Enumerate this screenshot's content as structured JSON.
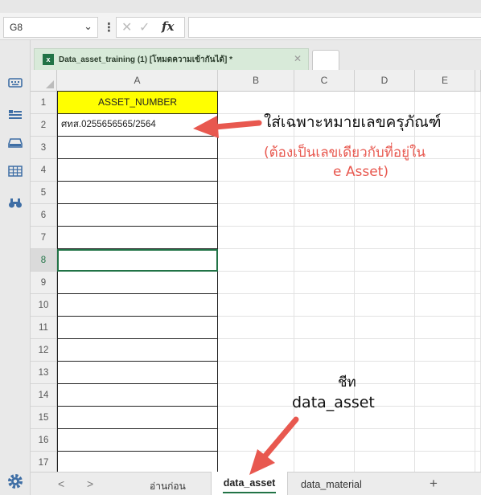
{
  "formula_bar": {
    "name_box": "G8",
    "name_box_arrow": "⌄",
    "separator": "⋮",
    "cancel_symbol": "✕",
    "confirm_symbol": "✓",
    "fx_label": "fx",
    "formula_value": ""
  },
  "document_tab": {
    "label": "Data_asset_training (1) [โหมดความเข้ากันได้] *",
    "icon_letter": "x",
    "close_symbol": "✕"
  },
  "grid": {
    "columns": [
      "A",
      "B",
      "C",
      "D",
      "E"
    ],
    "rows": [
      "1",
      "2",
      "3",
      "4",
      "5",
      "6",
      "7",
      "8",
      "9",
      "10",
      "11",
      "12",
      "13",
      "14",
      "15",
      "16",
      "17"
    ],
    "active_row": "8",
    "cells": {
      "A1": "ASSET_NUMBER",
      "A2": "ศทส.0255656565/2564"
    }
  },
  "sheet_tabs": {
    "prev_arrow": "<",
    "next_arrow": ">",
    "previous": "อ่านก่อน",
    "active": "data_asset",
    "other": "data_material",
    "add_symbol": "+"
  },
  "annotations": {
    "main_note": "ใส่เฉพาะหมายเลขครุภัณฑ์",
    "red_note_line1": "(ต้องเป็นเลขเดียวกับที่อยู่ใน",
    "red_note_line2": "e Asset)",
    "sheet_note_line1": "ชีท",
    "sheet_note_line2": "data_asset"
  },
  "colors": {
    "header_fill": "#ffff00",
    "accent_green": "#217346",
    "arrow_red": "#e8584f",
    "toolbar_blue": "#3e6ea5"
  },
  "icons": {
    "toolbar": [
      "keyboard-icon",
      "list-icon",
      "drive-icon",
      "table-icon",
      "binoculars-icon"
    ],
    "settings": "gear-icon"
  }
}
